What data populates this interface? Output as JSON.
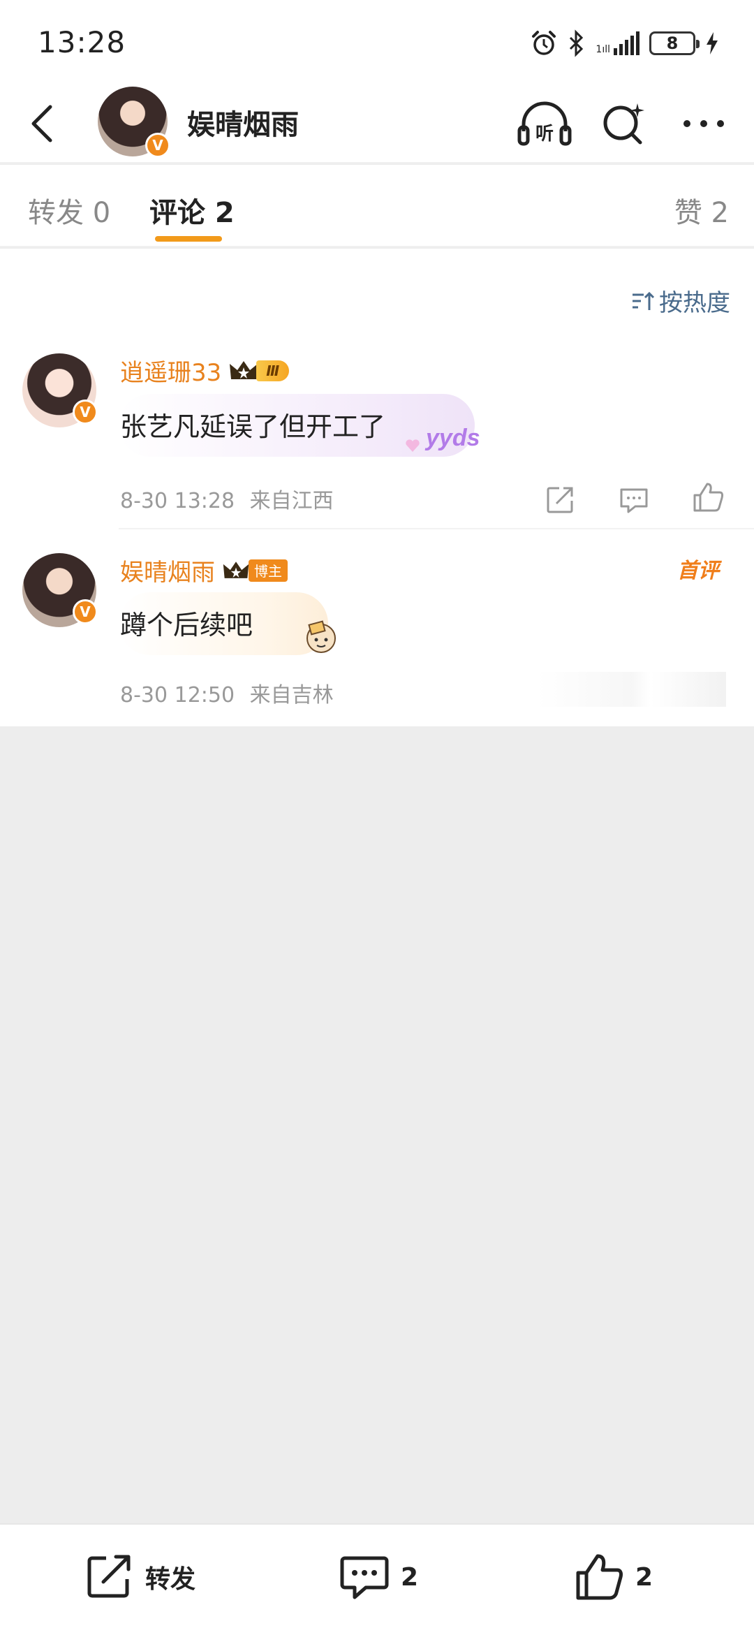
{
  "status_bar": {
    "time": "13:28",
    "battery": "8",
    "signal_label": "1ıll"
  },
  "header": {
    "author_name": "娱晴烟雨",
    "verified_mark": "V",
    "listen_label": "听"
  },
  "tabs": [
    {
      "label": "转发 0"
    },
    {
      "label": "评论 2"
    },
    {
      "label": "赞 2"
    }
  ],
  "sort": {
    "label": "按热度"
  },
  "comments": [
    {
      "user": "逍遥珊33",
      "level": "Ⅲ",
      "text": "张艺凡延误了但开工了",
      "sticker": "yyds",
      "date": "8-30 13:28",
      "location": "来自江西"
    },
    {
      "user": "娱晴烟雨",
      "blogger_tag": "博主",
      "first_tag": "首评",
      "text": "蹲个后续吧",
      "date": "8-30 12:50",
      "location": "来自吉林"
    }
  ],
  "bottom_bar": {
    "repost_label": "转发",
    "comment_count": "2",
    "like_count": "2"
  },
  "colors": {
    "accent": "#f29a1a",
    "username": "#e8821e",
    "link": "#4a6b8c",
    "background": "#ededed"
  },
  "icons": [
    "back-icon",
    "headphones-icon",
    "search-icon",
    "more-icon",
    "sort-icon",
    "share-icon",
    "comment-icon",
    "like-icon",
    "crown-icon",
    "verified-icon"
  ]
}
